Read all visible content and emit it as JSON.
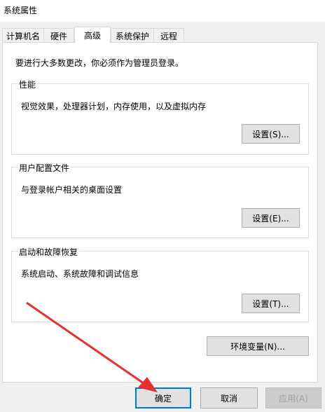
{
  "window": {
    "title": "系统属性"
  },
  "tabs": [
    {
      "label": "计算机名"
    },
    {
      "label": "硬件"
    },
    {
      "label": "高级"
    },
    {
      "label": "系统保护"
    },
    {
      "label": "远程"
    }
  ],
  "notice": "要进行大多数更改，你必须作为管理员登录。",
  "groups": [
    {
      "title": "性能",
      "desc": "视觉效果，处理器计划，内存使用，以及虚拟内存",
      "button": "设置(S)..."
    },
    {
      "title": "用户配置文件",
      "desc": "与登录帐户相关的桌面设置",
      "button": "设置(E)..."
    },
    {
      "title": "启动和故障恢复",
      "desc": "系统启动、系统故障和调试信息",
      "button": "设置(T)..."
    }
  ],
  "env_button": "环境变量(N)...",
  "footer": {
    "ok": "确定",
    "cancel": "取消",
    "apply": "应用(A)"
  },
  "colors": {
    "annotation_arrow": "#e8312f",
    "focus_border": "#0078d7"
  }
}
